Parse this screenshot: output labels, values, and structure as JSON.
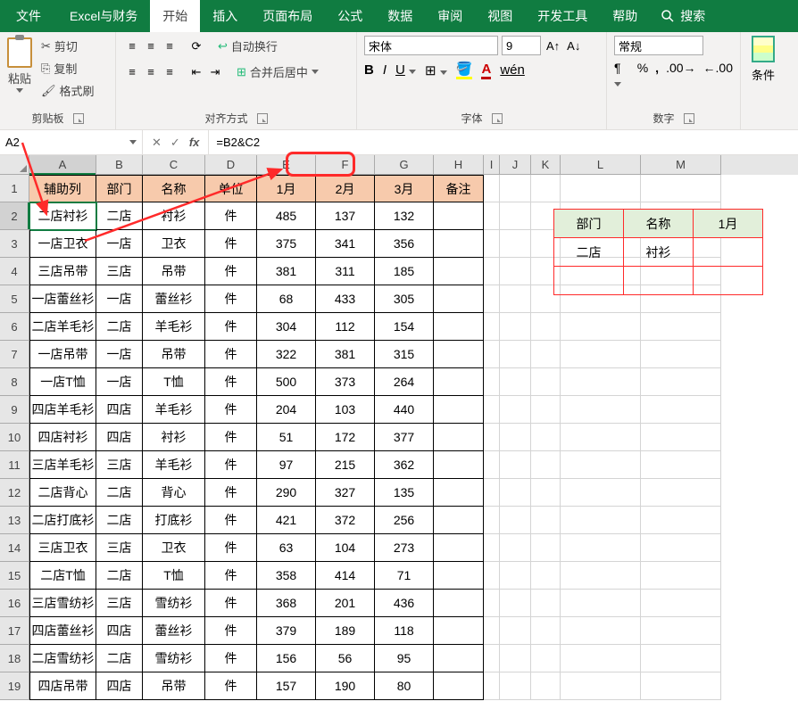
{
  "tabs": {
    "file": "文件",
    "finance": "Excel与财务",
    "home": "开始",
    "insert": "插入",
    "pagelayout": "页面布局",
    "formulas": "公式",
    "data": "数据",
    "review": "审阅",
    "view": "视图",
    "developer": "开发工具",
    "help": "帮助",
    "search": "搜索"
  },
  "ribbon": {
    "paste": "粘贴",
    "cut": "剪切",
    "copy": "复制",
    "formatpainter": "格式刷",
    "clipboard_label": "剪贴板",
    "wrap": "自动换行",
    "merge": "合并后居中",
    "alignment_label": "对齐方式",
    "font_name": "宋体",
    "font_size": "9",
    "font_label": "字体",
    "number_format": "常规",
    "number_label": "数字",
    "conditional_short": "条件",
    "wen": "wén"
  },
  "formula_bar": {
    "name_box": "A2",
    "formula": "=B2&C2"
  },
  "columns": [
    "A",
    "B",
    "C",
    "D",
    "E",
    "F",
    "G",
    "H",
    "I",
    "J",
    "K",
    "L",
    "M"
  ],
  "header_row": [
    "辅助列",
    "部门",
    "名称",
    "单位",
    "1月",
    "2月",
    "3月",
    "备注"
  ],
  "rows": [
    [
      "二店衬衫",
      "二店",
      "衬衫",
      "件",
      "485",
      "137",
      "132",
      ""
    ],
    [
      "一店卫衣",
      "一店",
      "卫衣",
      "件",
      "375",
      "341",
      "356",
      ""
    ],
    [
      "三店吊带",
      "三店",
      "吊带",
      "件",
      "381",
      "311",
      "185",
      ""
    ],
    [
      "一店蕾丝衫",
      "一店",
      "蕾丝衫",
      "件",
      "68",
      "433",
      "305",
      ""
    ],
    [
      "二店羊毛衫",
      "二店",
      "羊毛衫",
      "件",
      "304",
      "112",
      "154",
      ""
    ],
    [
      "一店吊带",
      "一店",
      "吊带",
      "件",
      "322",
      "381",
      "315",
      ""
    ],
    [
      "一店T恤",
      "一店",
      "T恤",
      "件",
      "500",
      "373",
      "264",
      ""
    ],
    [
      "四店羊毛衫",
      "四店",
      "羊毛衫",
      "件",
      "204",
      "103",
      "440",
      ""
    ],
    [
      "四店衬衫",
      "四店",
      "衬衫",
      "件",
      "51",
      "172",
      "377",
      ""
    ],
    [
      "三店羊毛衫",
      "三店",
      "羊毛衫",
      "件",
      "97",
      "215",
      "362",
      ""
    ],
    [
      "二店背心",
      "二店",
      "背心",
      "件",
      "290",
      "327",
      "135",
      ""
    ],
    [
      "二店打底衫",
      "二店",
      "打底衫",
      "件",
      "421",
      "372",
      "256",
      ""
    ],
    [
      "三店卫衣",
      "三店",
      "卫衣",
      "件",
      "63",
      "104",
      "273",
      ""
    ],
    [
      "二店T恤",
      "二店",
      "T恤",
      "件",
      "358",
      "414",
      "71",
      ""
    ],
    [
      "三店雪纺衫",
      "三店",
      "雪纺衫",
      "件",
      "368",
      "201",
      "436",
      ""
    ],
    [
      "四店蕾丝衫",
      "四店",
      "蕾丝衫",
      "件",
      "379",
      "189",
      "118",
      ""
    ],
    [
      "二店雪纺衫",
      "二店",
      "雪纺衫",
      "件",
      "156",
      "56",
      "95",
      ""
    ],
    [
      "四店吊带",
      "四店",
      "吊带",
      "件",
      "157",
      "190",
      "80",
      ""
    ]
  ],
  "lookup": {
    "headers": [
      "部门",
      "名称",
      "1月"
    ],
    "row1": [
      "二店",
      "衬衫",
      ""
    ],
    "row2": [
      "",
      "",
      ""
    ]
  }
}
